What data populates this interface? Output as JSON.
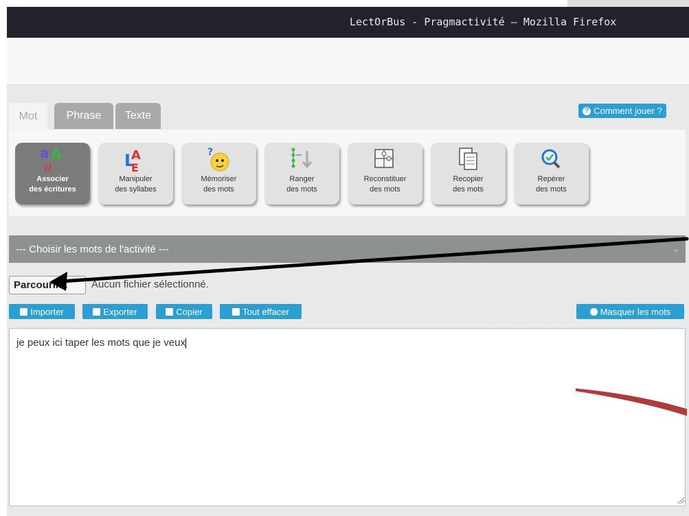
{
  "window": {
    "title": "LectOrBus - Pragmactivité — Mozilla Firefox"
  },
  "tabs": [
    {
      "label": "Mot",
      "active": true
    },
    {
      "label": "Phrase",
      "active": false
    },
    {
      "label": "Texte",
      "active": false
    }
  ],
  "help_button": {
    "label": "Comment jouer ?",
    "icon": "question-circle-icon"
  },
  "activities": [
    {
      "line1": "Associer",
      "line2": "des écritures",
      "icon": "letters-icon",
      "selected": true
    },
    {
      "line1": "Manipuler",
      "line2": "des syllabes",
      "icon": "syllables-icon",
      "selected": false
    },
    {
      "line1": "Mémoriser",
      "line2": "des mots",
      "icon": "thinking-face-icon",
      "selected": false
    },
    {
      "line1": "Ranger",
      "line2": "des mots",
      "icon": "sort-list-icon",
      "selected": false
    },
    {
      "line1": "Reconstituer",
      "line2": "des mots",
      "icon": "puzzle-icon",
      "selected": false
    },
    {
      "line1": "Recopier",
      "line2": "des mots",
      "icon": "copy-documents-icon",
      "selected": false
    },
    {
      "line1": "Repérer",
      "line2": "des mots",
      "icon": "magnifier-icon",
      "selected": false
    }
  ],
  "word_select": {
    "value": "--- Choisir les mots de l'activité ---"
  },
  "file_input": {
    "button_label": "Parcourir...",
    "status": "Aucun fichier sélectionné."
  },
  "actions": [
    {
      "label": "Importer",
      "icon": "import-icon"
    },
    {
      "label": "Exporter",
      "icon": "export-icon"
    },
    {
      "label": "Copier",
      "icon": "copy-icon"
    },
    {
      "label": "Tout effacer",
      "icon": "trash-icon"
    }
  ],
  "hide_words_button": {
    "label": "Masquer les mots",
    "icon": "eye-slash-icon"
  },
  "editor": {
    "text": "je peux ici taper les mots que je veux"
  },
  "colors": {
    "accent": "#2a9fd6",
    "titlebar": "#22212c",
    "select_bar": "#8e9191",
    "annotation_arrow": "#000000",
    "annotation_curve": "#b23a3a"
  }
}
